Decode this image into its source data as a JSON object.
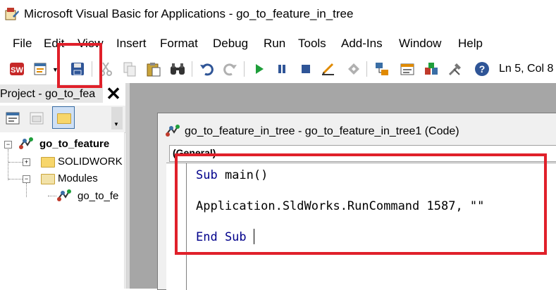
{
  "window": {
    "title": "Microsoft Visual Basic for Applications - go_to_feature_in_tree",
    "icon": "vba-app-icon"
  },
  "menu": {
    "items": [
      "File",
      "Edit",
      "View",
      "Insert",
      "Format",
      "Debug",
      "Run",
      "Tools",
      "Add-Ins",
      "Window",
      "Help"
    ]
  },
  "toolbar": {
    "buttons": [
      "solidworks-icon",
      "insert-module-icon",
      "save-icon",
      "cut-icon",
      "copy-icon",
      "paste-icon",
      "find-icon",
      "undo-icon",
      "redo-icon",
      "run-icon",
      "break-icon",
      "reset-icon",
      "design-mode-icon",
      "project-explorer-icon",
      "properties-icon",
      "object-browser-icon",
      "toolbox-icon",
      "help-icon"
    ],
    "status": "Ln 5, Col 8"
  },
  "project_panel": {
    "title": "Project - go_to_fea",
    "close_glyph": "✕",
    "tree": {
      "root": "go_to_feature",
      "solidworks": "SOLIDWORK",
      "modules": "Modules",
      "module_item": "go_to_fe"
    }
  },
  "code_window": {
    "title": "go_to_feature_in_tree - go_to_feature_in_tree1 (Code)",
    "object_combo": "(General)",
    "lines": [
      {
        "kw": "Sub",
        "rest": " main()"
      },
      {
        "kw": "",
        "rest": "Application.SldWorks.RunCommand 1587, \"\""
      },
      {
        "kw": "End Sub",
        "rest": ""
      }
    ]
  },
  "highlight_color": "#e0202a"
}
